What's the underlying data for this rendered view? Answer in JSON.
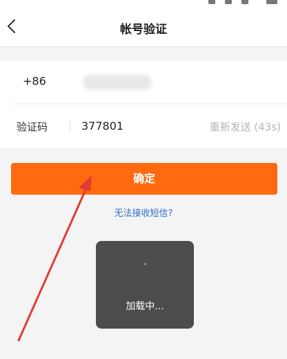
{
  "header": {
    "title": "帐号验证"
  },
  "form": {
    "country_code": "+86",
    "code_label": "验证码",
    "code_value": "377801",
    "resend_label": "重新发送 (43s)"
  },
  "actions": {
    "confirm_label": "确定",
    "no_sms_link": "无法接收短信?"
  },
  "loading": {
    "text": "加载中..."
  },
  "colors": {
    "accent": "#ff6a10",
    "link": "#2f6ecf",
    "annotation": "#e53935"
  }
}
